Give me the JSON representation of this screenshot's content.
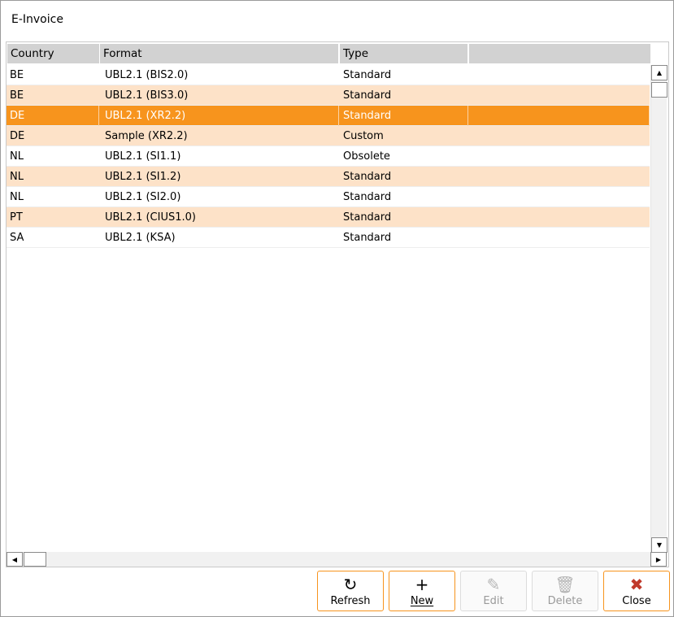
{
  "window": {
    "title": "E-Invoice"
  },
  "grid": {
    "columns": [
      "Country",
      "Format",
      "Type",
      ""
    ],
    "rows": [
      {
        "country": "BE",
        "format": "UBL2.1 (BIS2.0)",
        "type": "Standard",
        "selected": false
      },
      {
        "country": "BE",
        "format": "UBL2.1 (BIS3.0)",
        "type": "Standard",
        "selected": false
      },
      {
        "country": "DE",
        "format": "UBL2.1 (XR2.2)",
        "type": "Standard",
        "selected": true
      },
      {
        "country": "DE",
        "format": "Sample (XR2.2)",
        "type": "Custom",
        "selected": false
      },
      {
        "country": "NL",
        "format": "UBL2.1 (SI1.1)",
        "type": "Obsolete",
        "selected": false
      },
      {
        "country": "NL",
        "format": "UBL2.1 (SI1.2)",
        "type": "Standard",
        "selected": false
      },
      {
        "country": "NL",
        "format": "UBL2.1 (SI2.0)",
        "type": "Standard",
        "selected": false
      },
      {
        "country": "PT",
        "format": "UBL2.1 (CIUS1.0)",
        "type": "Standard",
        "selected": false
      },
      {
        "country": "SA",
        "format": "UBL2.1 (KSA)",
        "type": "Standard",
        "selected": false
      }
    ]
  },
  "toolbar": {
    "refresh_label": "Refresh",
    "new_label": "New",
    "edit_label": "Edit",
    "delete_label": "Delete",
    "close_label": "Close"
  },
  "colors": {
    "selected_row": "#f7941d",
    "alt_row": "#fde2c8",
    "button_border": "#f7941d",
    "close_icon": "#c0392b"
  },
  "icons": {
    "refresh": "refresh-icon",
    "new": "plus-icon",
    "edit": "pencil-icon",
    "delete": "trash-icon",
    "close": "x-icon"
  }
}
